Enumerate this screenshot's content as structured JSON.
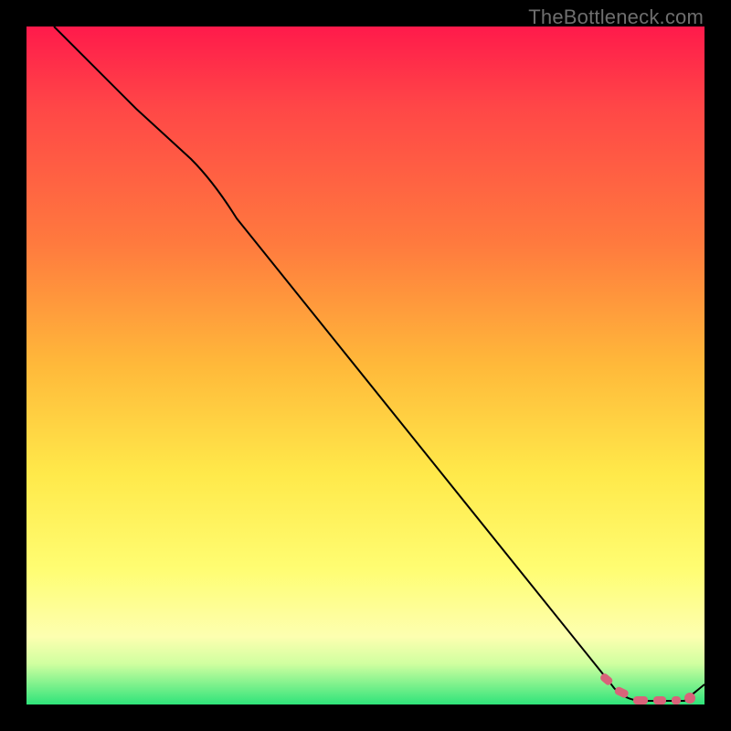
{
  "watermark": "TheBottleneck.com",
  "colors": {
    "background": "#000000",
    "gradient_top": "#ff1a4b",
    "gradient_bottom": "#2fe47a",
    "curve": "#000000",
    "marker": "#d9637a"
  },
  "chart_data": {
    "type": "line",
    "title": "",
    "xlabel": "",
    "ylabel": "",
    "grid": false,
    "legend": false,
    "xlim": [
      0,
      100
    ],
    "ylim": [
      0,
      100
    ],
    "note": "No axis ticks or numeric labels are present in the image; x/y values are estimated as 0–100 percent of the plot area read from pixel positions.",
    "series": [
      {
        "name": "bottleneck-curve",
        "style": "solid-black",
        "x": [
          4,
          10,
          15,
          20,
          25,
          30,
          35,
          40,
          45,
          50,
          55,
          60,
          65,
          70,
          75,
          80,
          84,
          86,
          88,
          90,
          92,
          94,
          96,
          100
        ],
        "y": [
          100,
          93,
          88,
          83,
          78,
          73,
          65,
          56,
          48,
          40,
          32,
          25,
          18,
          12,
          7,
          3,
          1,
          0.5,
          0.2,
          0.1,
          0.1,
          0.2,
          0.6,
          3
        ]
      }
    ],
    "markers": {
      "name": "highlighted-range",
      "style": "thick-dash-pink",
      "along_curve": true,
      "x_start": 84,
      "x_end": 96,
      "end_dot_x": 96,
      "end_dot_y": 0.6
    }
  }
}
